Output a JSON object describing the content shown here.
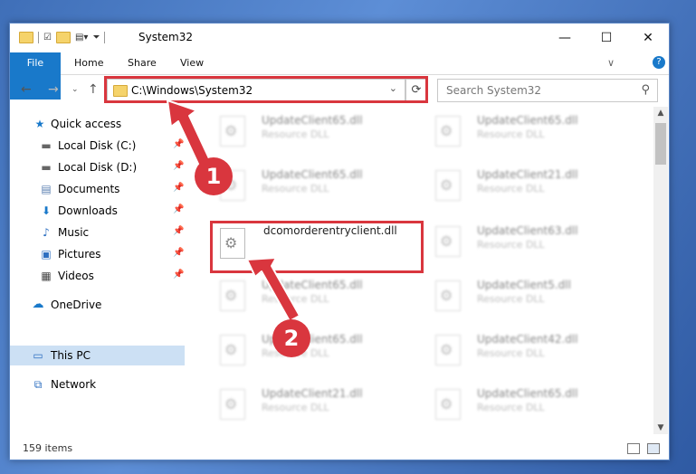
{
  "window": {
    "title": "System32",
    "controls": {
      "minimize": "—",
      "maximize": "☐",
      "close": "✕"
    }
  },
  "ribbon": {
    "tabs": [
      "File",
      "Home",
      "Share",
      "View"
    ],
    "collapse": "∨",
    "help": "?"
  },
  "address": {
    "path": "C:\\Windows\\System32",
    "search_placeholder": "Search System32"
  },
  "nav": {
    "items": [
      {
        "label": "Quick access"
      },
      {
        "label": "Local Disk (C:)"
      },
      {
        "label": "Local Disk (D:)"
      },
      {
        "label": "Documents"
      },
      {
        "label": "Downloads"
      },
      {
        "label": "Music"
      },
      {
        "label": "Pictures"
      },
      {
        "label": "Videos"
      },
      {
        "label": "OneDrive"
      },
      {
        "label": "This PC"
      },
      {
        "label": "Network"
      }
    ]
  },
  "files": {
    "left": [
      {
        "name": "UpdateClient65.dll",
        "type": "Resource DLL"
      },
      {
        "name": "UpdateClient65.dll",
        "type": "Resource DLL"
      },
      {
        "name": "dcomorderentryclient.dll",
        "type": ""
      },
      {
        "name": "UpdateClient65.dll",
        "type": "Resource DLL"
      },
      {
        "name": "UpdateClient65.dll",
        "type": "Resource DLL"
      },
      {
        "name": "UpdateClient21.dll",
        "type": "Resource DLL"
      }
    ],
    "right": [
      {
        "name": "UpdateClient65.dll",
        "type": "Resource DLL"
      },
      {
        "name": "UpdateClient21.dll",
        "type": "Resource DLL"
      },
      {
        "name": "UpdateClient63.dll",
        "type": "Resource DLL"
      },
      {
        "name": "UpdateClient5.dll",
        "type": "Resource DLL"
      },
      {
        "name": "UpdateClient42.dll",
        "type": "Resource DLL"
      },
      {
        "name": "UpdateClient65.dll",
        "type": "Resource DLL"
      }
    ]
  },
  "status": {
    "count": "159 items"
  },
  "annotations": {
    "marker1": "1",
    "marker2": "2",
    "color": "#d9363e"
  }
}
